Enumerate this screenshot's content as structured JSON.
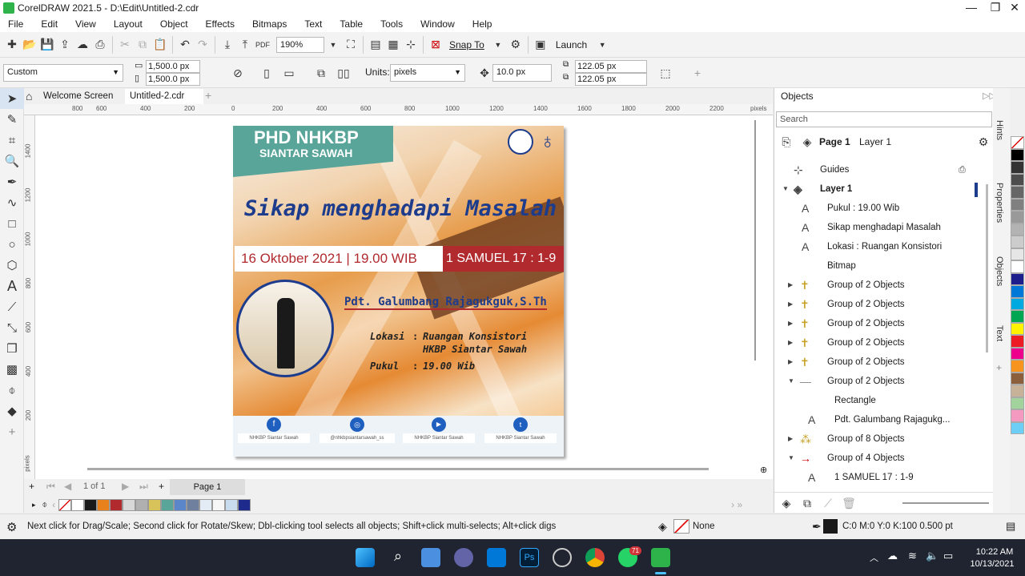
{
  "window": {
    "title": "CorelDRAW 2021.5 - D:\\Edit\\Untitled-2.cdr"
  },
  "menu": [
    "File",
    "Edit",
    "View",
    "Layout",
    "Object",
    "Effects",
    "Bitmaps",
    "Text",
    "Table",
    "Tools",
    "Window",
    "Help"
  ],
  "toolbar": {
    "zoom": "190%",
    "snap_label": "Snap To",
    "launch_label": "Launch"
  },
  "propbar": {
    "preset": "Custom",
    "width": "1,500.0 px",
    "height": "1,500.0 px",
    "units_label": "Units:",
    "units_value": "pixels",
    "nudge": "10.0 px",
    "dup_x": "122.05 px",
    "dup_y": "122.05 px"
  },
  "tabs": {
    "welcome": "Welcome Screen",
    "doc": "Untitled-2.cdr"
  },
  "ruler": {
    "top": [
      "800",
      "600",
      "400",
      "200",
      "0",
      "200",
      "400",
      "600",
      "800",
      "1000",
      "1200",
      "1400",
      "1600",
      "1800",
      "2000",
      "2200"
    ],
    "unit": "pixels",
    "left": [
      "1400",
      "1200",
      "1000",
      "800",
      "600",
      "400",
      "200"
    ],
    "left_unit": "pixels"
  },
  "poster": {
    "badge_title": "PHD NHKBP",
    "badge_sub": "SIANTAR SAWAH",
    "headline": "Sikap menghadapi Masalah",
    "date": "16 Oktober 2021 | 19.00 WIB",
    "verse": "1 SAMUEL 17 : 1-9",
    "speaker": "Pdt. Galumbang Rajagukguk,S.Th",
    "loc_label": "Lokasi",
    "loc_sep": ":",
    "loc1": "Ruangan Konsistori",
    "loc2": "HKBP Siantar Sawah",
    "time_label": "Pukul",
    "time_sep": ":",
    "time": "19.00 Wib",
    "socials": [
      "NHKBP Siantar Sawah",
      "@nhkbpsiantarsawah_ss",
      "NHKBP Siantar Sawah",
      "NHKBP Siantar Sawah"
    ],
    "social_icons": [
      "facebook-icon",
      "instagram-icon",
      "youtube-icon",
      "twitter-icon"
    ]
  },
  "pager": {
    "count": "1 of 1",
    "page": "Page 1"
  },
  "objects": {
    "title": "Objects",
    "search": "Search",
    "page": "Page 1",
    "layer": "Layer 1",
    "items": [
      {
        "label": "Guides",
        "type": "guides"
      },
      {
        "label": "Layer 1",
        "type": "layer"
      },
      {
        "label": "Pukul : 19.00 Wib",
        "type": "A"
      },
      {
        "label": "Sikap menghadapi Masalah",
        "type": "A"
      },
      {
        "label": "Lokasi : Ruangan Konsistori",
        "type": "A"
      },
      {
        "label": "Bitmap",
        "type": "bitmap"
      },
      {
        "label": "Group of 2 Objects",
        "type": "group"
      },
      {
        "label": "Group of 2 Objects",
        "type": "group"
      },
      {
        "label": "Group of 2 Objects",
        "type": "group"
      },
      {
        "label": "Group of 2 Objects",
        "type": "group"
      },
      {
        "label": "Group of 2 Objects",
        "type": "group"
      },
      {
        "label": "Group of 2 Objects",
        "type": "group"
      },
      {
        "label": "Rectangle",
        "type": "rect"
      },
      {
        "label": "Pdt. Galumbang Rajagukg...",
        "type": "A"
      },
      {
        "label": "Group of 8 Objects",
        "type": "group"
      },
      {
        "label": "Group of 4 Objects",
        "type": "group"
      },
      {
        "label": "1 SAMUEL 17 : 1-9",
        "type": "A"
      }
    ]
  },
  "sidetabs": [
    "Hints",
    "Properties",
    "Objects",
    "Text"
  ],
  "status": {
    "hint": "Next click for Drag/Scale; Second click for Rotate/Skew; Dbl-clicking tool selects all objects; Shift+click multi-selects; Alt+click digs",
    "fill": "None",
    "outline": "C:0 M:0 Y:0 K:100  0.500 pt"
  },
  "taskbar": {
    "time": "10:22 AM",
    "date": "10/13/2021",
    "badge": "71"
  },
  "colors": {
    "accent": "#1e3c8c",
    "badge": "#5aa59a",
    "verse_bg": "#b02a2e"
  }
}
